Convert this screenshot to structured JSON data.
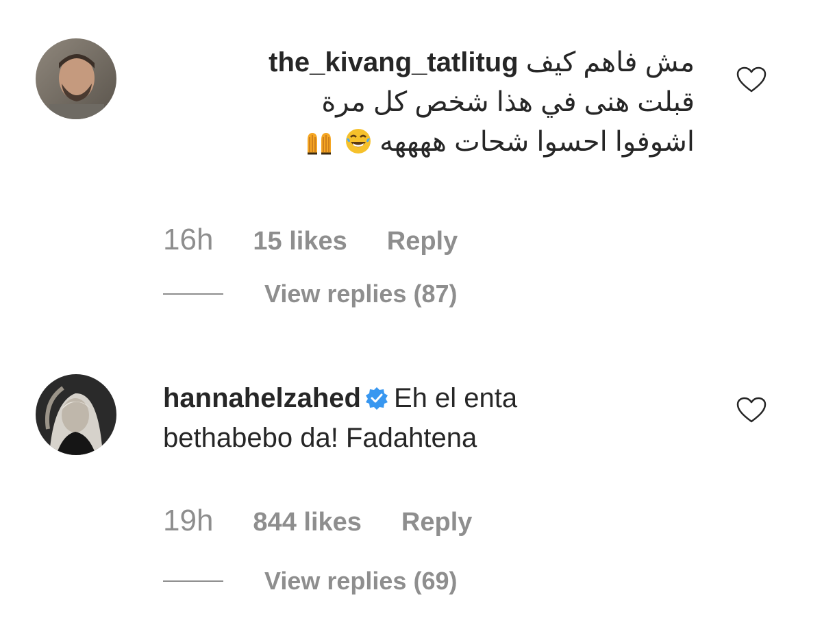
{
  "comments": [
    {
      "username": "the_kivang_tatlitug",
      "text_line1": "مش فاهم كيف",
      "text_line2": "قبلت هنى في هذا شخص كل مرة",
      "text_line3": "اشوفوا احسوا شحات ههههه",
      "emojis": [
        "raising-hands-emoji",
        "tears-of-joy-emoji"
      ],
      "time": "16h",
      "likes": "15 likes",
      "reply_label": "Reply",
      "view_replies": "View replies (87)",
      "verified": false
    },
    {
      "username": "hannahelzahed",
      "text_line1": "Eh el enta",
      "text_line2": "bethabebo da! Fadahtena",
      "time": "19h",
      "likes": "844 likes",
      "reply_label": "Reply",
      "view_replies": "View replies (69)",
      "verified": true
    }
  ],
  "colors": {
    "text": "#262626",
    "secondary": "#8e8e8e",
    "verified_blue": "#3897f0",
    "background": "#ffffff"
  },
  "icons": {
    "like": "heart-outline-icon",
    "verified": "verified-badge-icon"
  }
}
